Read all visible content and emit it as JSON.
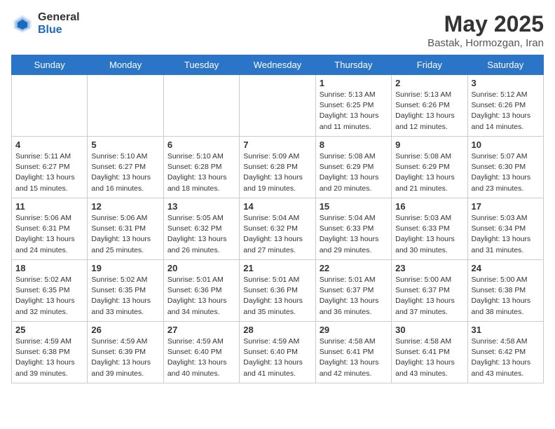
{
  "logo": {
    "general": "General",
    "blue": "Blue"
  },
  "title": {
    "month_year": "May 2025",
    "location": "Bastak, Hormozgan, Iran"
  },
  "weekdays": [
    "Sunday",
    "Monday",
    "Tuesday",
    "Wednesday",
    "Thursday",
    "Friday",
    "Saturday"
  ],
  "weeks": [
    [
      {
        "day": "",
        "info": ""
      },
      {
        "day": "",
        "info": ""
      },
      {
        "day": "",
        "info": ""
      },
      {
        "day": "",
        "info": ""
      },
      {
        "day": "1",
        "info": "Sunrise: 5:13 AM\nSunset: 6:25 PM\nDaylight: 13 hours\nand 11 minutes."
      },
      {
        "day": "2",
        "info": "Sunrise: 5:13 AM\nSunset: 6:26 PM\nDaylight: 13 hours\nand 12 minutes."
      },
      {
        "day": "3",
        "info": "Sunrise: 5:12 AM\nSunset: 6:26 PM\nDaylight: 13 hours\nand 14 minutes."
      }
    ],
    [
      {
        "day": "4",
        "info": "Sunrise: 5:11 AM\nSunset: 6:27 PM\nDaylight: 13 hours\nand 15 minutes."
      },
      {
        "day": "5",
        "info": "Sunrise: 5:10 AM\nSunset: 6:27 PM\nDaylight: 13 hours\nand 16 minutes."
      },
      {
        "day": "6",
        "info": "Sunrise: 5:10 AM\nSunset: 6:28 PM\nDaylight: 13 hours\nand 18 minutes."
      },
      {
        "day": "7",
        "info": "Sunrise: 5:09 AM\nSunset: 6:28 PM\nDaylight: 13 hours\nand 19 minutes."
      },
      {
        "day": "8",
        "info": "Sunrise: 5:08 AM\nSunset: 6:29 PM\nDaylight: 13 hours\nand 20 minutes."
      },
      {
        "day": "9",
        "info": "Sunrise: 5:08 AM\nSunset: 6:29 PM\nDaylight: 13 hours\nand 21 minutes."
      },
      {
        "day": "10",
        "info": "Sunrise: 5:07 AM\nSunset: 6:30 PM\nDaylight: 13 hours\nand 23 minutes."
      }
    ],
    [
      {
        "day": "11",
        "info": "Sunrise: 5:06 AM\nSunset: 6:31 PM\nDaylight: 13 hours\nand 24 minutes."
      },
      {
        "day": "12",
        "info": "Sunrise: 5:06 AM\nSunset: 6:31 PM\nDaylight: 13 hours\nand 25 minutes."
      },
      {
        "day": "13",
        "info": "Sunrise: 5:05 AM\nSunset: 6:32 PM\nDaylight: 13 hours\nand 26 minutes."
      },
      {
        "day": "14",
        "info": "Sunrise: 5:04 AM\nSunset: 6:32 PM\nDaylight: 13 hours\nand 27 minutes."
      },
      {
        "day": "15",
        "info": "Sunrise: 5:04 AM\nSunset: 6:33 PM\nDaylight: 13 hours\nand 29 minutes."
      },
      {
        "day": "16",
        "info": "Sunrise: 5:03 AM\nSunset: 6:33 PM\nDaylight: 13 hours\nand 30 minutes."
      },
      {
        "day": "17",
        "info": "Sunrise: 5:03 AM\nSunset: 6:34 PM\nDaylight: 13 hours\nand 31 minutes."
      }
    ],
    [
      {
        "day": "18",
        "info": "Sunrise: 5:02 AM\nSunset: 6:35 PM\nDaylight: 13 hours\nand 32 minutes."
      },
      {
        "day": "19",
        "info": "Sunrise: 5:02 AM\nSunset: 6:35 PM\nDaylight: 13 hours\nand 33 minutes."
      },
      {
        "day": "20",
        "info": "Sunrise: 5:01 AM\nSunset: 6:36 PM\nDaylight: 13 hours\nand 34 minutes."
      },
      {
        "day": "21",
        "info": "Sunrise: 5:01 AM\nSunset: 6:36 PM\nDaylight: 13 hours\nand 35 minutes."
      },
      {
        "day": "22",
        "info": "Sunrise: 5:01 AM\nSunset: 6:37 PM\nDaylight: 13 hours\nand 36 minutes."
      },
      {
        "day": "23",
        "info": "Sunrise: 5:00 AM\nSunset: 6:37 PM\nDaylight: 13 hours\nand 37 minutes."
      },
      {
        "day": "24",
        "info": "Sunrise: 5:00 AM\nSunset: 6:38 PM\nDaylight: 13 hours\nand 38 minutes."
      }
    ],
    [
      {
        "day": "25",
        "info": "Sunrise: 4:59 AM\nSunset: 6:38 PM\nDaylight: 13 hours\nand 39 minutes."
      },
      {
        "day": "26",
        "info": "Sunrise: 4:59 AM\nSunset: 6:39 PM\nDaylight: 13 hours\nand 39 minutes."
      },
      {
        "day": "27",
        "info": "Sunrise: 4:59 AM\nSunset: 6:40 PM\nDaylight: 13 hours\nand 40 minutes."
      },
      {
        "day": "28",
        "info": "Sunrise: 4:59 AM\nSunset: 6:40 PM\nDaylight: 13 hours\nand 41 minutes."
      },
      {
        "day": "29",
        "info": "Sunrise: 4:58 AM\nSunset: 6:41 PM\nDaylight: 13 hours\nand 42 minutes."
      },
      {
        "day": "30",
        "info": "Sunrise: 4:58 AM\nSunset: 6:41 PM\nDaylight: 13 hours\nand 43 minutes."
      },
      {
        "day": "31",
        "info": "Sunrise: 4:58 AM\nSunset: 6:42 PM\nDaylight: 13 hours\nand 43 minutes."
      }
    ]
  ]
}
